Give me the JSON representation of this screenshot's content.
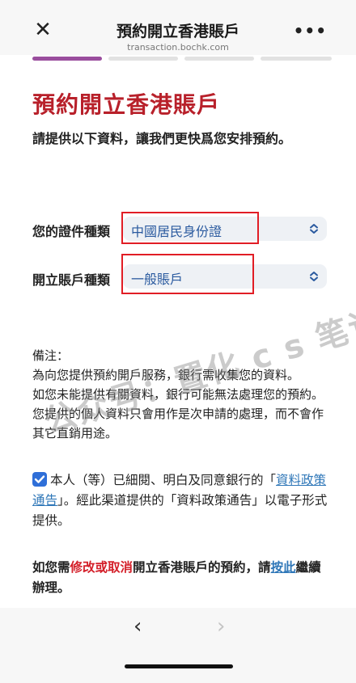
{
  "header": {
    "close_icon": "close-icon",
    "title": "預約開立香港賬戶",
    "domain": "transaction.bochk.com",
    "more_icon": "more-icon",
    "more_glyph": "•••"
  },
  "progress": {
    "total_steps": 4,
    "current_step": 1,
    "active_color": "#9a4e9e"
  },
  "page": {
    "heading": "預約開立香港賬戶",
    "intro": "請提供以下資料，讓我們更快爲您安排預約。"
  },
  "form": {
    "id_type_label": "您的證件種類",
    "id_type_value": "中國居民身份證",
    "account_type_label": "開立賬戶種類",
    "account_type_value": "一般賬戶"
  },
  "notes": {
    "title": "備注：",
    "line1": "為向您提供預約開戶服務，銀行需收集您的資料。",
    "line2": "如您未能提供有關資料，銀行可能無法處理您的預約。您提供的個人資料只會用作是次申請的處理，而不會作其它直銷用途。"
  },
  "watermark": "公众号：置化  c  s 笔记",
  "consent": {
    "checked": true,
    "text_before": "本人（等）已細閱、明白及同意銀行的「",
    "link_text": "資料政策通告",
    "text_after": "」。經此渠道提供的「資料政策通告」以電子形式提供。"
  },
  "footer_note": {
    "part1": "如您需",
    "emphasis": "修改或取消",
    "part2": "開立香港賬戶的預約，請",
    "link_text": "按此",
    "part3": "繼續辦理。"
  },
  "bottom_nav": {
    "back_glyph": "‹",
    "forward_glyph": "›"
  },
  "colors": {
    "brand_red": "#b8202a",
    "link_blue": "#2f77b8",
    "highlight_red": "#e11d25"
  }
}
